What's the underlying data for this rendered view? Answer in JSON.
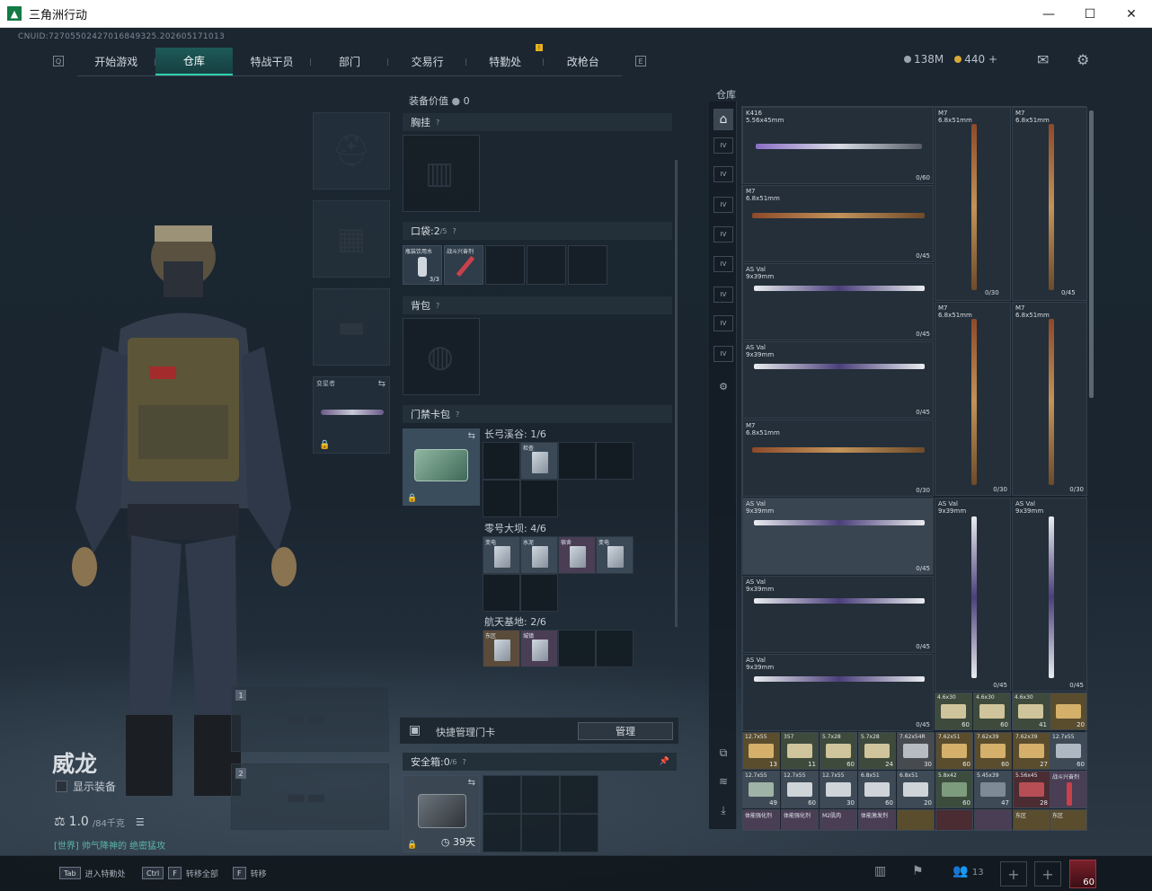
{
  "window": {
    "title": "三角洲行动",
    "minimize": "—",
    "maximize": "☐",
    "close": "✕"
  },
  "header": {
    "uid": "CNUID:72705502427016849325.202605171013",
    "tabs": [
      "开始游戏",
      "仓库",
      "特战干员",
      "部门",
      "交易行",
      "特勤处",
      "改枪台"
    ],
    "active_tab": "仓库",
    "currency_silver": "138M",
    "currency_gold": "440 +",
    "mail_icon": "mail-icon",
    "settings_icon": "gear-icon"
  },
  "operator": {
    "name": "威龙",
    "show_gear": "显示装备",
    "weight": "1.0",
    "weight_max": "/84千克",
    "chat": "[世界] 帅气降神的 绝密猛攻",
    "secondary_label": "变星者",
    "weapon_slots": [
      "1",
      "2"
    ]
  },
  "equipment": {
    "value_label": "装备价值",
    "value": "0",
    "rig": "胸挂",
    "pockets": "口袋: ",
    "pockets_count": "2",
    "pockets_max": "/5",
    "pocket_items": [
      {
        "label": "瓶装饮用水",
        "count": "3/3"
      },
      {
        "label": "战斗兴奋剂",
        "count": ""
      }
    ],
    "backpack": "背包",
    "keycard_pack": "门禁卡包",
    "maps": [
      {
        "name": "长弓溪谷: 1/6",
        "cards": [
          "检查"
        ]
      },
      {
        "name": "零号大坝: 4/6",
        "cards": [
          "变电",
          "水泥",
          "宿舍",
          "变电"
        ]
      },
      {
        "name": "航天基地: 2/6",
        "cards": [
          "东区",
          "城镇"
        ]
      }
    ],
    "quick_manage": "快捷管理门卡",
    "manage_btn": "管理",
    "safebox": "安全箱: ",
    "safebox_count": "0",
    "safebox_max": "/6",
    "safebox_days": "39天"
  },
  "warehouse": {
    "label": "仓库",
    "weapons": [
      {
        "name": "K416\n5.56x45mm",
        "count": "0/60"
      },
      {
        "name": "M7\n6.8x51mm",
        "count": ""
      },
      {
        "name": "M7\n6.8x51mm",
        "count": ""
      },
      {
        "name": "M7\n6.8x51mm",
        "count": "0/45"
      },
      {
        "name": "",
        "count": "0/30"
      },
      {
        "name": "",
        "count": "0/45"
      },
      {
        "name": "AS Val\n9x39mm",
        "count": "0/45"
      },
      {
        "name": "AS Val\n9x39mm",
        "count": "0/45"
      },
      {
        "name": "M7\n6.8x51mm",
        "count": "0/30"
      },
      {
        "name": "M7\n6.8x51mm",
        "count": "0/30"
      },
      {
        "name": "M7\n6.8x51mm",
        "count": "0/30"
      },
      {
        "name": "AS Val\n9x39mm",
        "count": "0/45"
      },
      {
        "name": "AS Val\n9x39mm",
        "count": "0/45"
      },
      {
        "name": "AS Val\n9x39mm",
        "count": "0/45"
      },
      {
        "name": "AS Val\n9x39mm",
        "count": "0/45"
      },
      {
        "name": "AS Val\n9x39mm",
        "count": "0/45"
      }
    ],
    "ammo_row1": [
      {
        "name": "4.6x30",
        "count": "60"
      },
      {
        "name": "4.6x30",
        "count": "60"
      },
      {
        "name": "4.6x30",
        "count": "41"
      },
      {
        "name": "",
        "count": "20"
      }
    ],
    "ammo_row2": [
      {
        "name": "12.7x55",
        "count": "13"
      },
      {
        "name": "357",
        "count": "11"
      },
      {
        "name": "5.7x28",
        "count": "60"
      },
      {
        "name": "5.7x28",
        "count": "24"
      },
      {
        "name": "7.62x54R",
        "count": "30"
      },
      {
        "name": "7.62x51",
        "count": "60"
      },
      {
        "name": "7.62x39",
        "count": "60"
      },
      {
        "name": "7.62x39",
        "count": "27"
      },
      {
        "name": "12.7x55",
        "count": "60"
      }
    ],
    "ammo_row3": [
      {
        "name": "12.7x55",
        "count": "49"
      },
      {
        "name": "12.7x55",
        "count": "60"
      },
      {
        "name": "12.7x55",
        "count": "30"
      },
      {
        "name": "6.8x51",
        "count": "60"
      },
      {
        "name": "6.8x51",
        "count": "20"
      },
      {
        "name": "5.8x42",
        "count": "60"
      },
      {
        "name": "5.45x39",
        "count": "47"
      },
      {
        "name": "5.56x45",
        "count": "28"
      },
      {
        "name": "战斗兴奋剂",
        "count": ""
      }
    ],
    "ammo_row4": [
      {
        "name": "体能强化剂",
        "count": ""
      },
      {
        "name": "体能强化剂",
        "count": ""
      },
      {
        "name": "M2肌肉",
        "count": ""
      },
      {
        "name": "体能激发剂",
        "count": ""
      },
      {
        "name": "",
        "count": ""
      },
      {
        "name": "",
        "count": ""
      },
      {
        "name": "",
        "count": ""
      },
      {
        "name": "东区",
        "count": ""
      },
      {
        "name": "东区",
        "count": ""
      }
    ]
  },
  "bottom": {
    "hint1_key": "Tab",
    "hint1": "进入特勤处",
    "hint2_key": "Ctrl",
    "hint2_key2": "F",
    "hint2": "转移全部",
    "hint3_key": "F",
    "hint3": "转移",
    "friends": "13",
    "level": "60"
  }
}
